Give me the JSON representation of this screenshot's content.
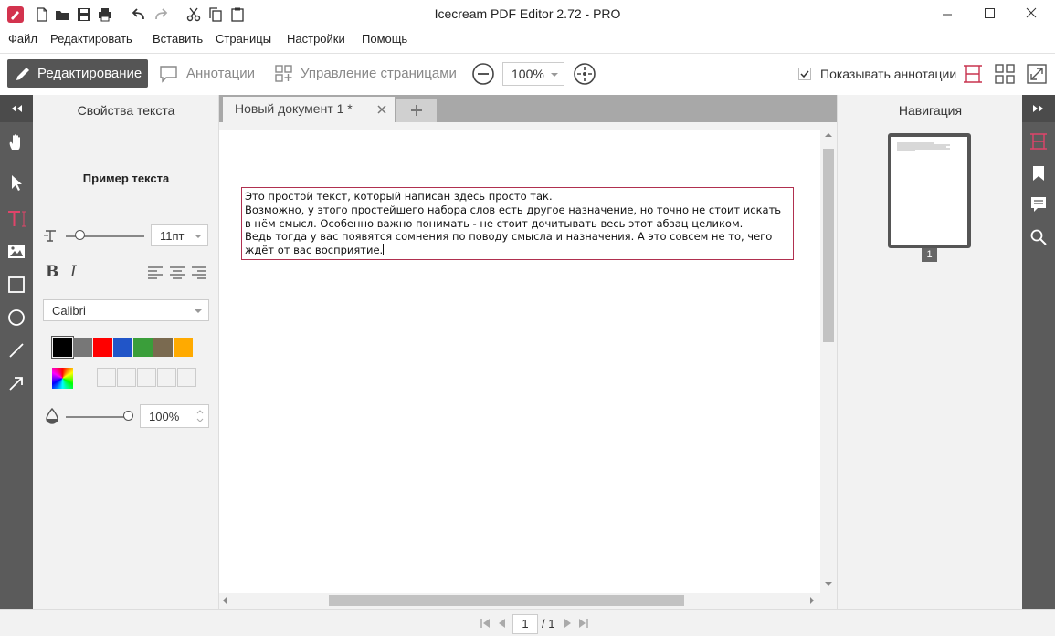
{
  "app": {
    "title": "Icecream PDF Editor 2.72 - PRO"
  },
  "menu": [
    "Файл",
    "Редактировать",
    "Вставить",
    "Страницы",
    "Настройки",
    "Помощь"
  ],
  "toolbar": {
    "mode_edit": "Редактирование",
    "mode_annotations": "Аннотации",
    "mode_pages": "Управление страницами",
    "zoom": "100%",
    "show_annotations": "Показывать аннотации",
    "show_annotations_checked": true
  },
  "props": {
    "title": "Свойства текста",
    "sample": "Пример текста",
    "font_size": "11пт",
    "font_name": "Calibri",
    "opacity": "100%",
    "colors": [
      "#000000",
      "#777777",
      "#ff0000",
      "#2155c8",
      "#3a9e3a",
      "#7a6a50",
      "#ffaa00"
    ]
  },
  "document": {
    "tab_title": "Новый документ 1 *",
    "text_lines": [
      "Это простой текст, который написан здесь просто так.",
      "Возможно, у этого простейшего набора слов есть другое назначение, но точно не стоит искать",
      "в нём смысл. Особенно важно понимать - не стоит дочитывать весь этот абзац целиком.",
      "Ведь тогда у вас появятся сомнения по поводу смысла и назначения. А это совсем не то, чего",
      "ждёт от вас восприятие."
    ]
  },
  "nav": {
    "title": "Навигация",
    "thumb_number": "1"
  },
  "status": {
    "current_page": "1",
    "total": "/ 1"
  },
  "colors": {
    "accent": "#c8334f",
    "strip": "#5b5b5b"
  }
}
